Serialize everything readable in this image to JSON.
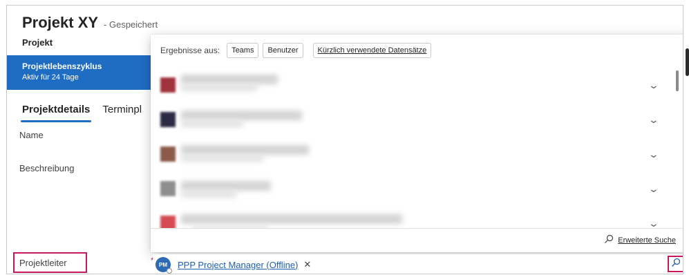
{
  "header": {
    "title": "Projekt XY",
    "saved_status": "- Gespeichert",
    "entity": "Projekt"
  },
  "bpf": {
    "title": "Projektlebenszyklus",
    "subtitle": "Aktiv für 24 Tage"
  },
  "tabs": [
    {
      "label": "Projektdetails",
      "active": true
    },
    {
      "label": "Terminpl",
      "active": false
    }
  ],
  "fields": {
    "name_label": "Name",
    "beschreibung_label": "Beschreibung",
    "projektleiter_label": "Projektleiter",
    "required_marker": "*"
  },
  "lookup": {
    "avatar_initials": "PM",
    "value": "PPP Project Manager (Offline)",
    "remove_glyph": "✕"
  },
  "dropdown": {
    "results_from_label": "Ergebnisse aus:",
    "filters": [
      "Teams",
      "Benutzer"
    ],
    "recent_label": "Kürzlich verwendete Datensätze",
    "avatar_colors": [
      "#a0333d",
      "#2c2b45",
      "#8b5a49",
      "#8e8e8e",
      "#d44b52"
    ],
    "advanced_search_label": "Erweiterte Suche"
  },
  "colors": {
    "accent": "#1f6cc3",
    "highlight": "#c8185b"
  }
}
